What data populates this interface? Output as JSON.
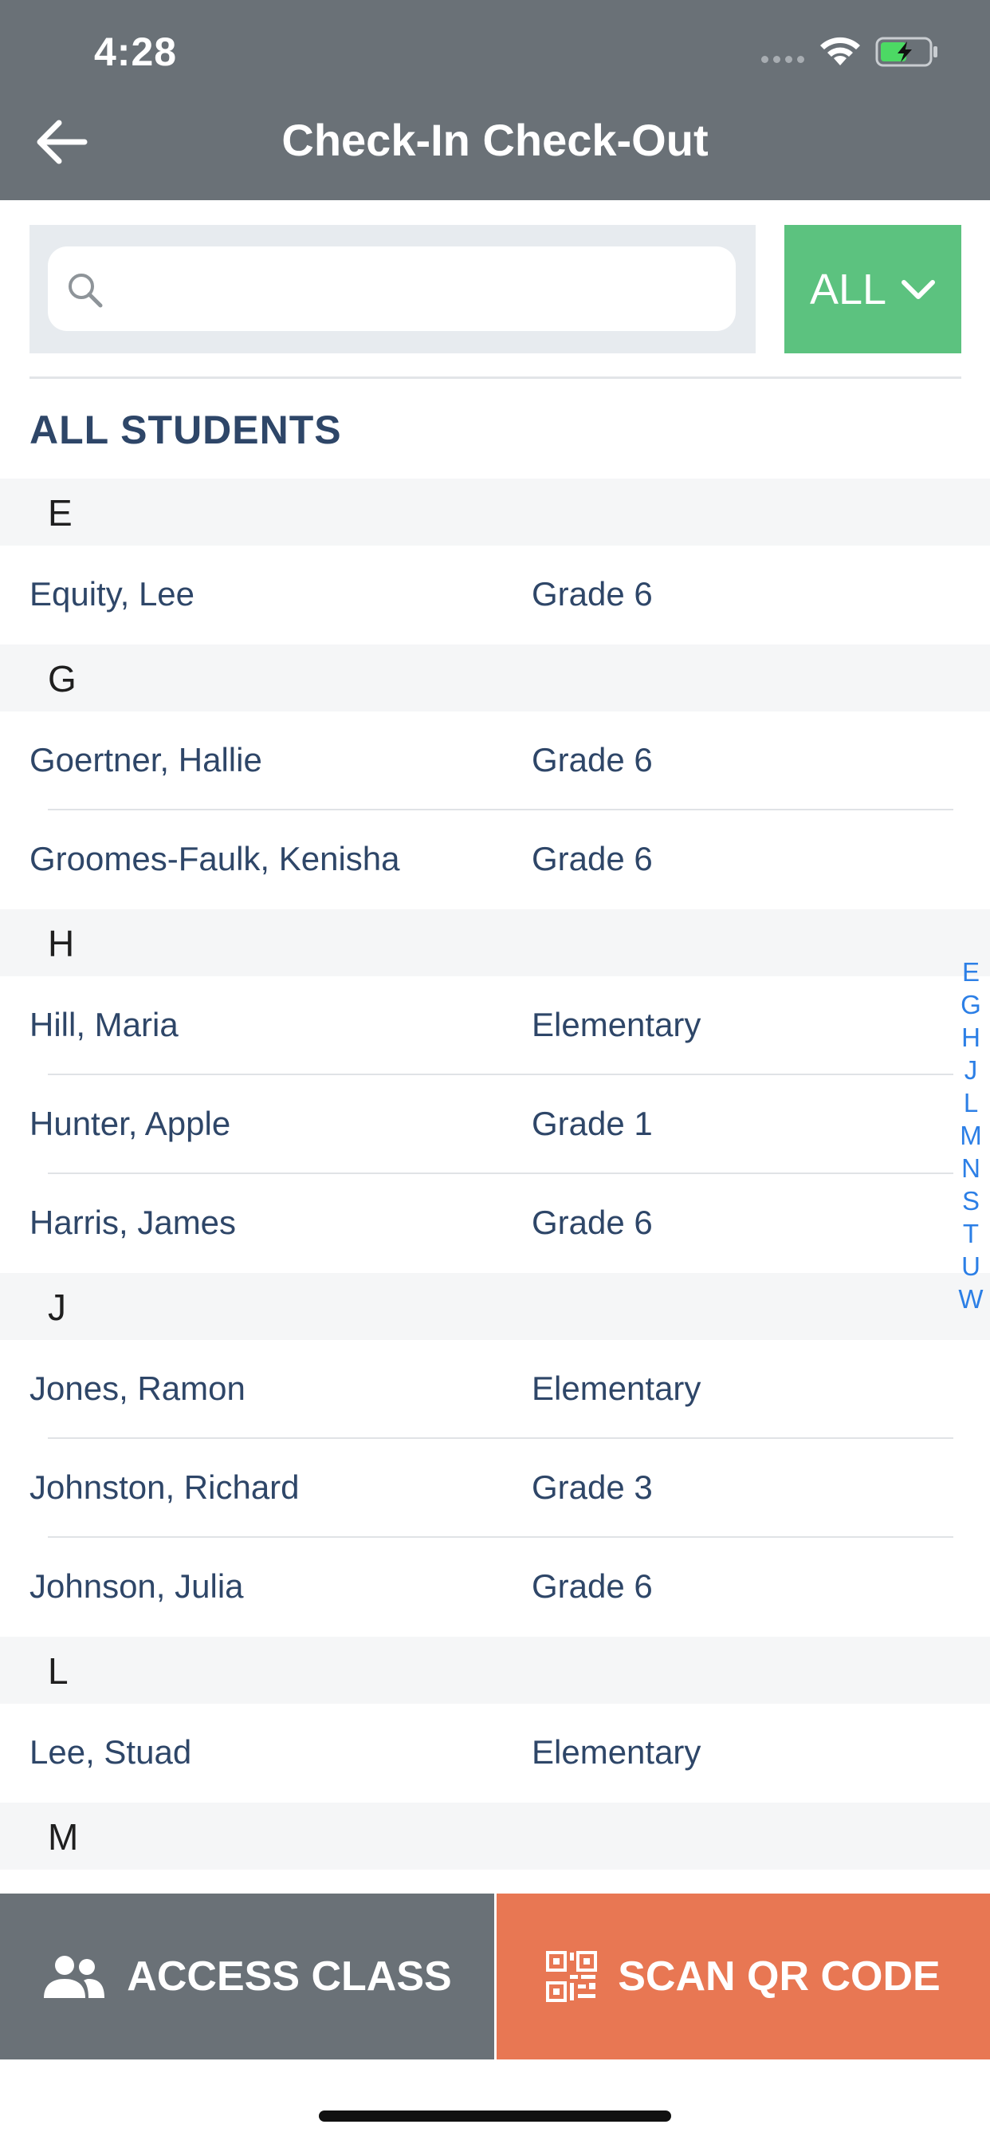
{
  "status_bar": {
    "time": "4:28"
  },
  "header": {
    "title": "Check-In Check-Out",
    "back_icon": "arrow-left-icon"
  },
  "search": {
    "value": "",
    "placeholder": ""
  },
  "filter": {
    "label": "ALL"
  },
  "section_title": "ALL STUDENTS",
  "groups": [
    {
      "letter": "E",
      "students": [
        {
          "name": "Equity, Lee",
          "grade": "Grade 6"
        }
      ]
    },
    {
      "letter": "G",
      "students": [
        {
          "name": "Goertner, Hallie",
          "grade": "Grade 6"
        },
        {
          "name": "Groomes-Faulk, Kenisha",
          "grade": "Grade 6"
        }
      ]
    },
    {
      "letter": "H",
      "students": [
        {
          "name": "Hill, Maria",
          "grade": "Elementary"
        },
        {
          "name": "Hunter, Apple",
          "grade": "Grade 1"
        },
        {
          "name": "Harris, James",
          "grade": "Grade 6"
        }
      ]
    },
    {
      "letter": "J",
      "students": [
        {
          "name": "Jones, Ramon",
          "grade": "Elementary"
        },
        {
          "name": "Johnston, Richard",
          "grade": "Grade 3"
        },
        {
          "name": "Johnson, Julia",
          "grade": "Grade 6"
        }
      ]
    },
    {
      "letter": "L",
      "students": [
        {
          "name": "Lee, Stuad",
          "grade": "Elementary"
        }
      ]
    },
    {
      "letter": "M",
      "students": []
    }
  ],
  "index_letters": [
    "E",
    "G",
    "H",
    "J",
    "L",
    "M",
    "N",
    "S",
    "T",
    "U",
    "W"
  ],
  "bottom": {
    "access_label": "ACCESS CLASS",
    "scan_label": "SCAN QR CODE"
  },
  "colors": {
    "header_bg": "#6a7177",
    "filter_bg": "#5cc27f",
    "scan_bg": "#e87753",
    "text_primary": "#2e4668",
    "index_blue": "#2c7fe6"
  }
}
